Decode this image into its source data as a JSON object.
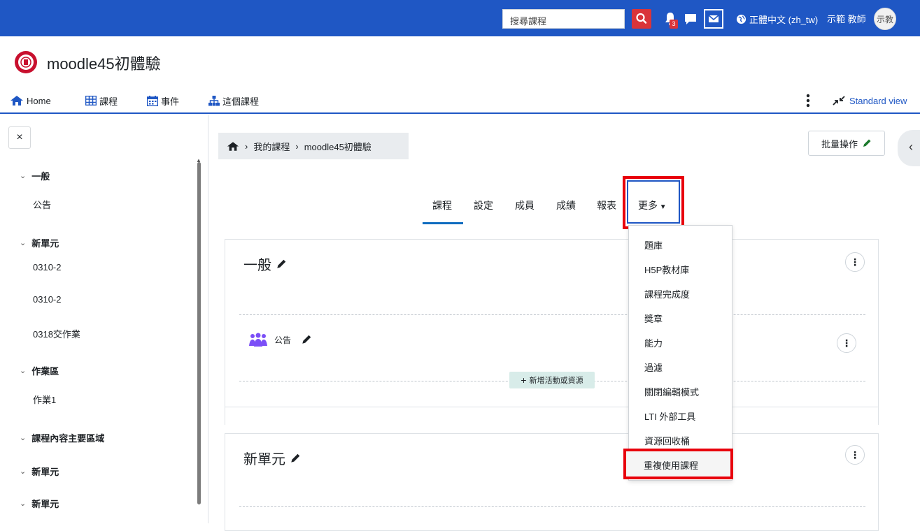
{
  "topbar": {
    "search_placeholder": "搜尋課程",
    "notification_count": "3",
    "language": "正體中文 (zh_tw)",
    "user_name": "示範 教師",
    "avatar_initials": "示教",
    "bar_color": "#1f57c4"
  },
  "site": {
    "name": "moodle45初體驗"
  },
  "nav": {
    "items": [
      {
        "label": "Home",
        "icon": "home-icon"
      },
      {
        "label": "課程",
        "icon": "grid-icon"
      },
      {
        "label": "事件",
        "icon": "calendar-icon"
      },
      {
        "label": "這個課程",
        "icon": "sitemap-icon"
      }
    ],
    "standard_view": "Standard view"
  },
  "drawer": {
    "close": "×",
    "sections": [
      {
        "title": "一般",
        "items": [
          "公告"
        ]
      },
      {
        "title": "新單元",
        "items": [
          "0310-2",
          "0310-2",
          "0318交作業"
        ]
      },
      {
        "title": "作業區",
        "items": [
          "作業1"
        ]
      },
      {
        "title": "課程內容主要區域",
        "items": []
      },
      {
        "title": "新單元",
        "items": []
      },
      {
        "title": "新單元",
        "items": []
      }
    ]
  },
  "breadcrumb": {
    "items": [
      "我的課程",
      "moodle45初體驗"
    ]
  },
  "bulk_edit": "批量操作",
  "tabs": [
    "課程",
    "設定",
    "成員",
    "成績",
    "報表",
    "更多"
  ],
  "sections": [
    {
      "title": "一般",
      "activity": "公告",
      "add_label": "新增活動或資源"
    },
    {
      "title": "新單元"
    }
  ],
  "more_menu": [
    "題庫",
    "H5P教材庫",
    "課程完成度",
    "獎章",
    "能力",
    "過濾",
    "關閉編輯模式",
    "LTI 外部工具",
    "資源回收桶",
    "重複使用課程"
  ],
  "highlight_color": "#e8000c"
}
